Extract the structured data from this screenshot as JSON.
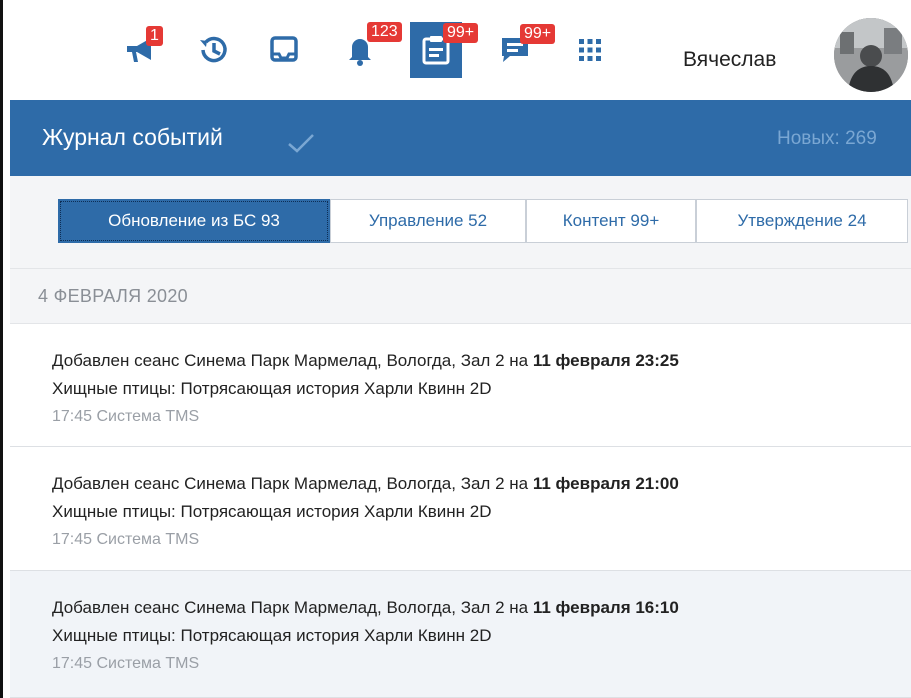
{
  "topbar": {
    "icons": [
      {
        "name": "megaphone-icon",
        "badge": "1"
      },
      {
        "name": "history-icon",
        "badge": ""
      },
      {
        "name": "inbox-icon",
        "badge": ""
      },
      {
        "name": "bell-icon",
        "badge": "123"
      },
      {
        "name": "event-log-icon",
        "badge": "99+"
      },
      {
        "name": "messages-icon",
        "badge": "99+"
      },
      {
        "name": "apps-grid-icon",
        "badge": ""
      }
    ],
    "user_name": "Вячеслав"
  },
  "panel": {
    "title": "Журнал событий",
    "new_count": "Новых: 269"
  },
  "tabs": [
    {
      "label": "Обновление из БС 93",
      "active": true
    },
    {
      "label": "Управление 52",
      "active": false
    },
    {
      "label": "Контент 99+",
      "active": false
    },
    {
      "label": "Утверждение 24",
      "active": false
    }
  ],
  "date_header": "4 ФЕВРАЛЯ 2020",
  "events": [
    {
      "text": "Добавлен сеанс Синема Парк Мармелад, Вологда, Зал 2 на ",
      "when": "11 февраля 23:25",
      "film": "Хищные птицы: Потрясающая история Харли Квинн 2D",
      "meta": "17:45 Система TMS"
    },
    {
      "text": "Добавлен сеанс Синема Парк Мармелад, Вологда, Зал 2 на ",
      "when": "11 февраля 21:00",
      "film": "Хищные птицы: Потрясающая история Харли Квинн 2D",
      "meta": "17:45 Система TMS"
    },
    {
      "text": "Добавлен сеанс Синема Парк Мармелад, Вологда, Зал 2 на ",
      "when": "11 февраля 16:10",
      "film": "Хищные птицы: Потрясающая история Харли Квинн 2D",
      "meta": "17:45 Система TMS"
    }
  ],
  "colors": {
    "accent": "#2e6ba8",
    "badge": "#e53935",
    "icon": "#2e6ba8"
  }
}
